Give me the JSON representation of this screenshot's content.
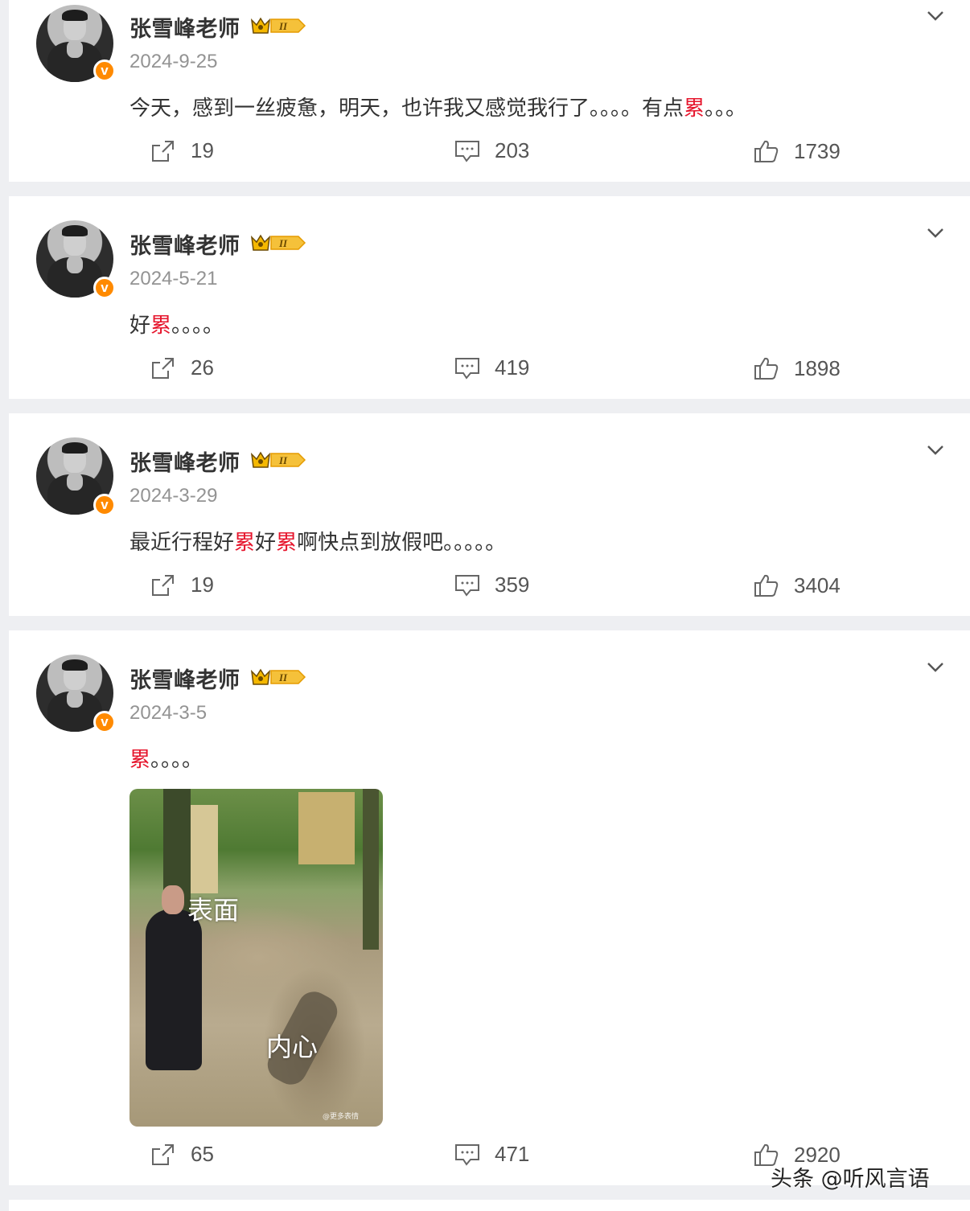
{
  "posts": [
    {
      "user": "张雪峰老师",
      "date": "2024-9-25",
      "text_parts": [
        "今天，感到一丝疲惫，明天，也许我又感觉我行了。。。。有点",
        "累",
        "。。。"
      ],
      "reposts": "19",
      "comments": "203",
      "likes": "1739"
    },
    {
      "user": "张雪峰老师",
      "date": "2024-5-21",
      "text_parts": [
        "好",
        "累",
        "。。。。"
      ],
      "reposts": "26",
      "comments": "419",
      "likes": "1898"
    },
    {
      "user": "张雪峰老师",
      "date": "2024-3-29",
      "text_parts": [
        "最近行程好",
        "累",
        "好",
        "累",
        "啊快点到放假吧。。。。。"
      ],
      "reposts": "19",
      "comments": "359",
      "likes": "3404"
    },
    {
      "user": "张雪峰老师",
      "date": "2024-3-5",
      "text_parts": [
        "",
        "累",
        "。。。。"
      ],
      "image": {
        "caption_top": "表面",
        "caption_bottom": "内心",
        "watermark": "@更多表情"
      },
      "reposts": "65",
      "comments": "471",
      "likes": "2920"
    }
  ],
  "badge_letter": "v",
  "crown_label": "II",
  "watermark": "头条 @听风言语",
  "colors": {
    "highlight": "#e6162d",
    "badge": "#ff8a00",
    "crown_gold": "#f5b800"
  },
  "icons": [
    "repost-icon",
    "comment-icon",
    "like-icon",
    "chevron-down-icon",
    "crown-icon",
    "verified-icon"
  ]
}
